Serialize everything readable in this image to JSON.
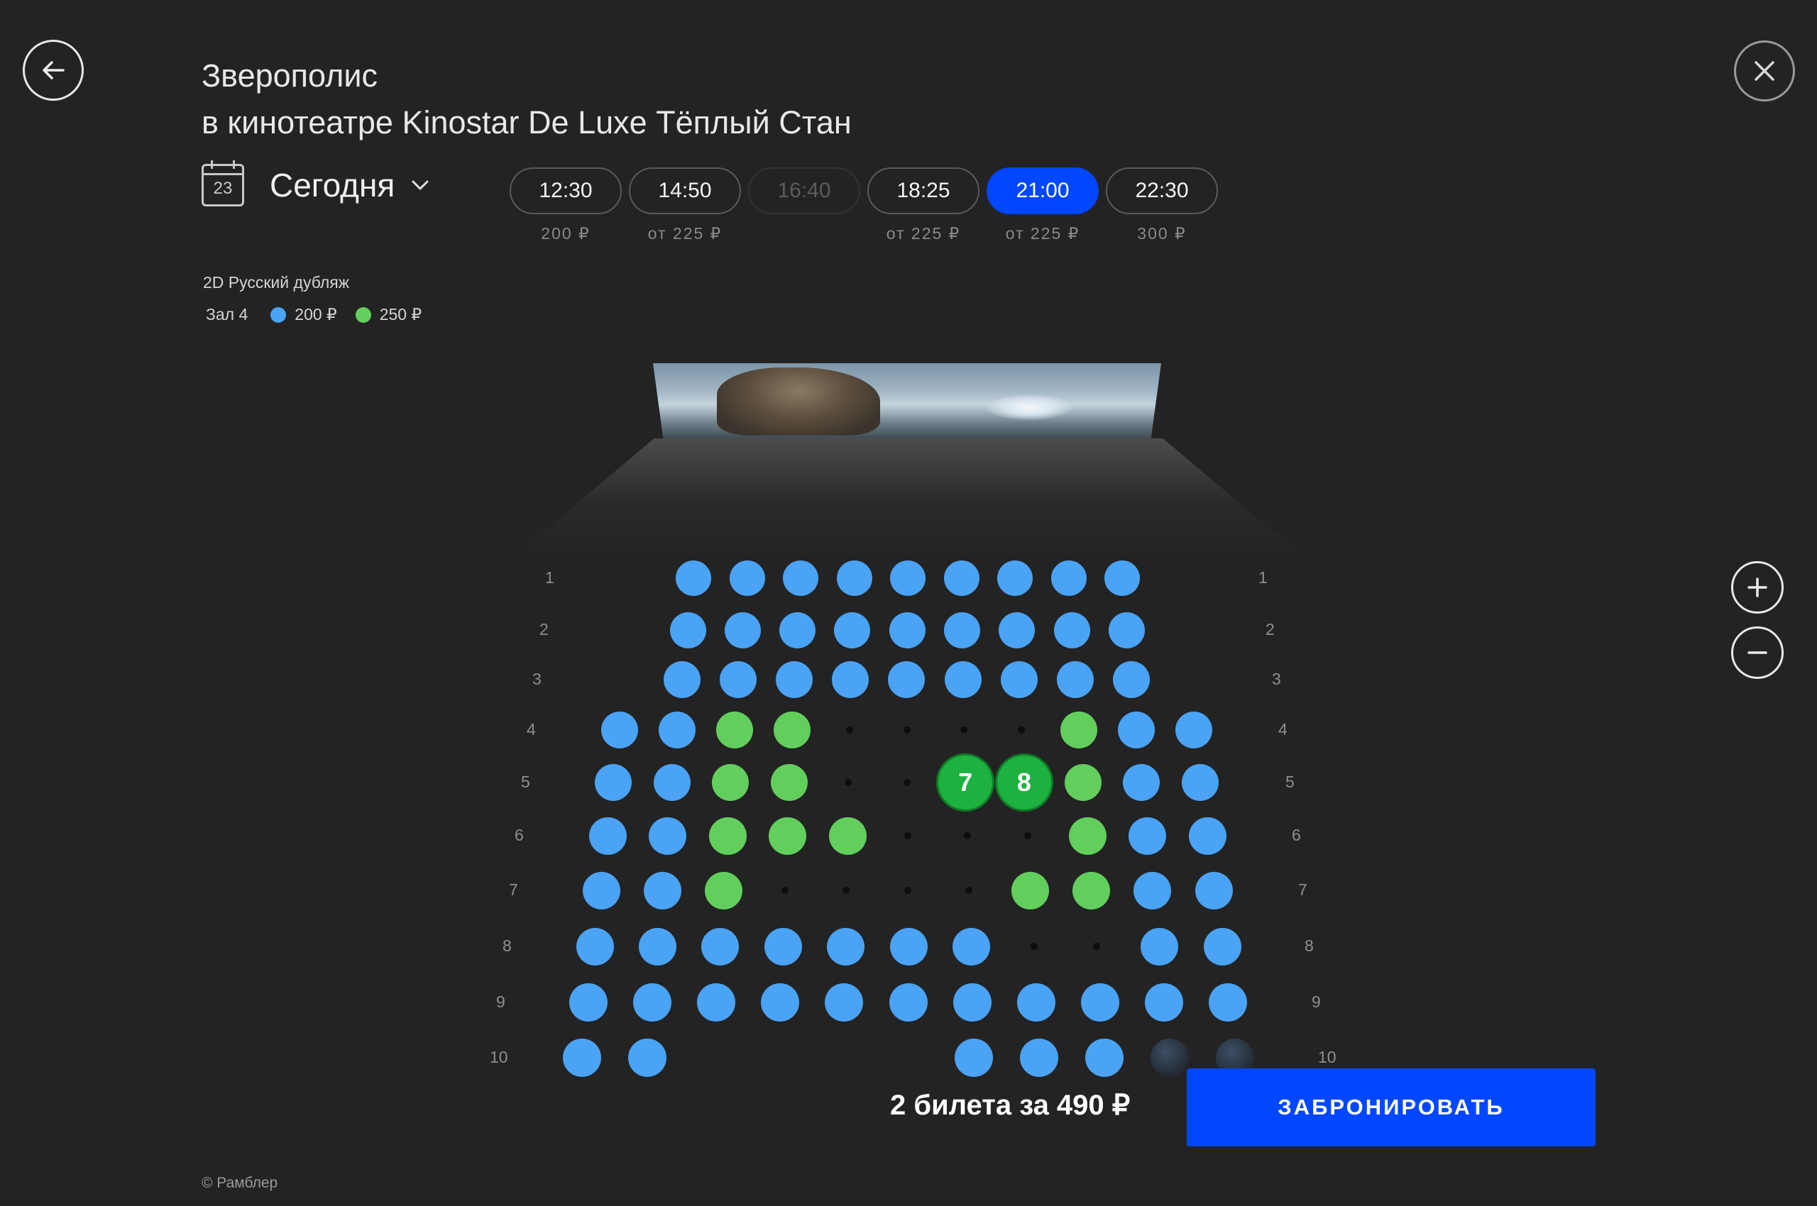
{
  "header": {
    "movie_title": "Зверополис",
    "cinema_line": "в кинотеатре Kinostar De Luxe Тёплый Стан"
  },
  "date": {
    "calendar_day": "23",
    "label": "Сегодня"
  },
  "showtimes": [
    {
      "time": "12:30",
      "price": "200 ₽",
      "state": "available"
    },
    {
      "time": "14:50",
      "price": "от 225 ₽",
      "state": "available"
    },
    {
      "time": "16:40",
      "price": "",
      "state": "disabled"
    },
    {
      "time": "18:25",
      "price": "от 225 ₽",
      "state": "available"
    },
    {
      "time": "21:00",
      "price": "от 225 ₽",
      "state": "selected"
    },
    {
      "time": "22:30",
      "price": "300 ₽",
      "state": "available"
    }
  ],
  "session": {
    "format": "2D Русский дубляж",
    "hall": "Зал 4",
    "price_legend": [
      {
        "label": "200 ₽",
        "color": "#4aa3f5"
      },
      {
        "label": "250 ₽",
        "color": "#62cf5c"
      }
    ]
  },
  "hall_rows": [
    {
      "label": "1",
      "seats": "BBBBBBBBB"
    },
    {
      "label": "2",
      "seats": "BBBBBBBBB"
    },
    {
      "label": "3",
      "seats": "BBBBBBBBB"
    },
    {
      "label": "4",
      "seats": "BBGG....GBB"
    },
    {
      "label": "5",
      "seats": "BBGG..78GBB"
    },
    {
      "label": "6",
      "seats": "BBGGG...GBB"
    },
    {
      "label": "7",
      "seats": "BBG....GGBB"
    },
    {
      "label": "8",
      "seats": "BBBBBBB..BB"
    },
    {
      "label": "9",
      "seats": "BBBBBBBBBBB"
    },
    {
      "label": "10",
      "seats": "BB____BBBDD"
    }
  ],
  "selected_seats": [
    {
      "row": "5",
      "seat": "7"
    },
    {
      "row": "5",
      "seat": "8"
    }
  ],
  "seat_colors": {
    "blue": "#4aa3f5",
    "green": "#62cf5c",
    "selected": "#1db13f",
    "accent": "#0047ff"
  },
  "summary": "2 билета за 490 ₽",
  "book_button": "ЗАБРОНИРОВАТЬ",
  "footer": "© Рамблер",
  "icons": [
    "arrow-left-icon",
    "close-icon",
    "calendar-icon",
    "chevron-down-icon",
    "plus-icon",
    "minus-icon"
  ]
}
